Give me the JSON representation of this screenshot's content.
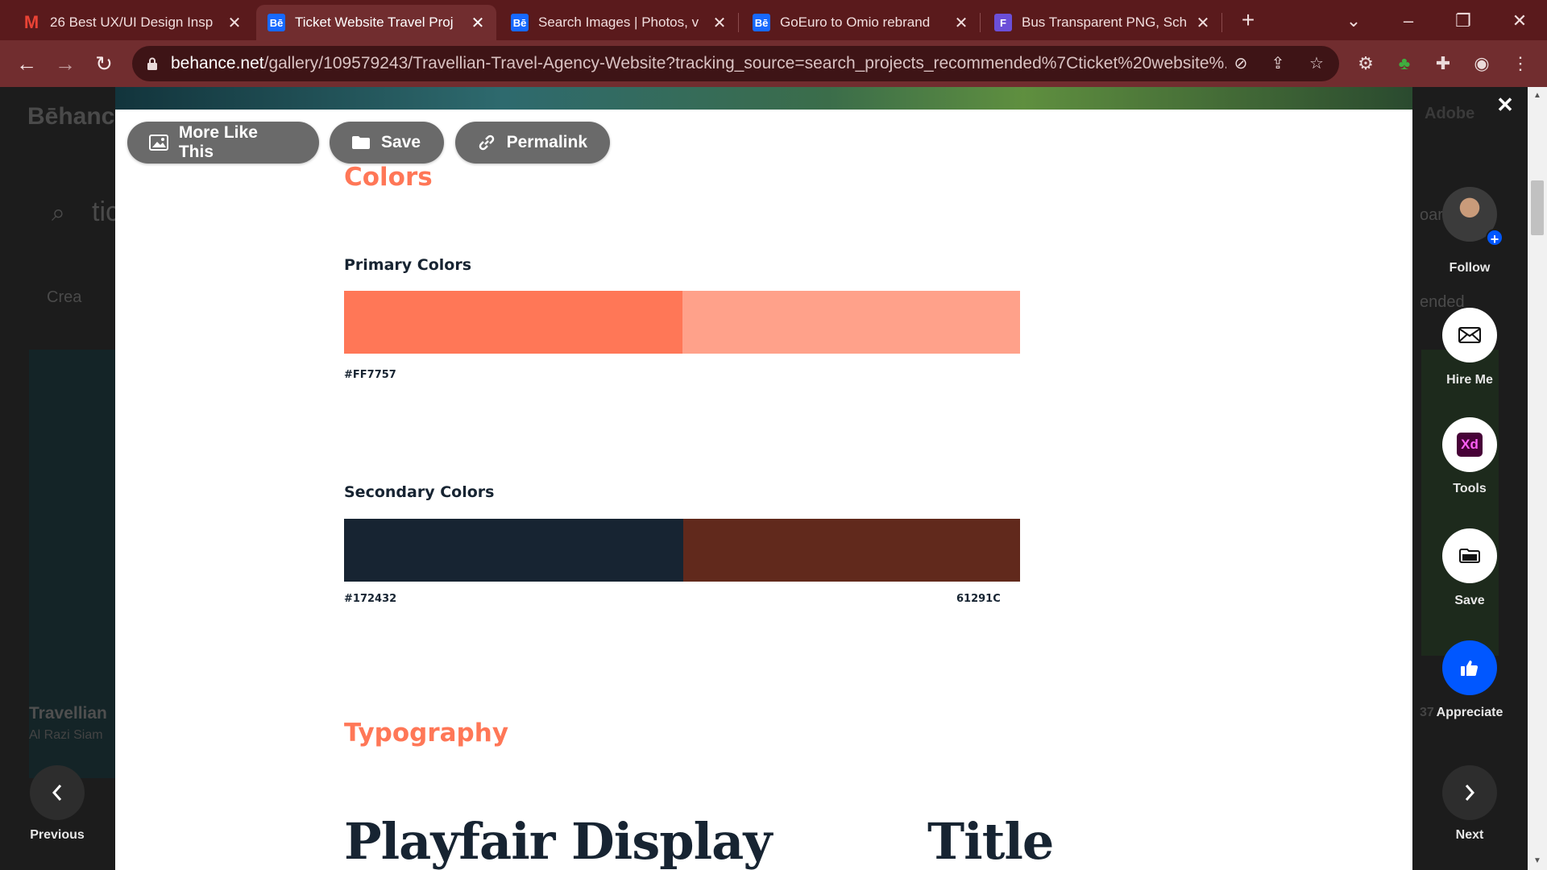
{
  "browser": {
    "tabs": [
      {
        "title": "26 Best UX/UI Design Insp",
        "favicon": "gmail-icon"
      },
      {
        "title": "Ticket Website Travel Proj",
        "favicon": "behance-icon",
        "active": true
      },
      {
        "title": "Search Images | Photos, v",
        "favicon": "behance-icon"
      },
      {
        "title": "GoEuro to Omio rebrand",
        "favicon": "behance-icon"
      },
      {
        "title": "Bus Transparent PNG, Sch",
        "favicon": "freepng-icon"
      }
    ],
    "favicon_text": {
      "behance": "Bē",
      "gmail": "M",
      "freepng": "F"
    },
    "url_host": "behance.net",
    "url_path": "/gallery/109579243/Travellian-Travel-Agency-Website?tracking_source=search_projects_recommended%7Cticket%20website%..."
  },
  "background_page": {
    "logo": "Bēhance",
    "search_text": "tic",
    "create_label": "Crea",
    "project_title": "Travellian",
    "project_author": "Al Razi Siam",
    "adobe_label": "Adobe",
    "right_text_1": "oar",
    "right_text_2": "ended",
    "count": "37"
  },
  "modal": {
    "toolbar": {
      "more_like_this": "More Like This",
      "save": "Save",
      "permalink": "Permalink"
    },
    "colors_heading": "Colors",
    "primary_heading": "Primary Colors",
    "primary_colors": [
      "#FF7757",
      "#FFA18A"
    ],
    "primary_labels": [
      "#FF7757"
    ],
    "secondary_heading": "Secondary Colors",
    "secondary_colors": [
      "#172432",
      "#61291C"
    ],
    "secondary_labels": [
      "#172432",
      "61291C"
    ],
    "typography_heading": "Typography",
    "font_name": "Playfair Display",
    "font_usage": "Title"
  },
  "rail": {
    "follow": "Follow",
    "hire_me": "Hire Me",
    "tools": "Tools",
    "tools_badge": "Xd",
    "save": "Save",
    "appreciate": "Appreciate"
  },
  "nav": {
    "previous": "Previous",
    "next": "Next"
  },
  "colors": {
    "accent": "#ff7757",
    "navy": "#172432",
    "behance_blue": "#0057ff",
    "chrome_tab": "#712d2f"
  }
}
